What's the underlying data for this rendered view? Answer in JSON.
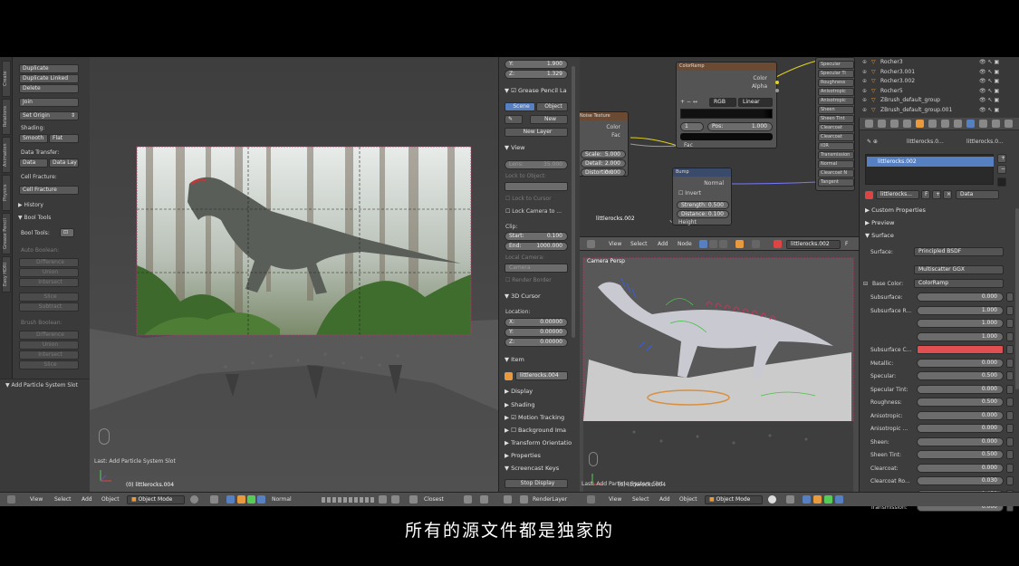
{
  "left_tools": {
    "duplicate": "Duplicate",
    "duplicate_linked": "Duplicate Linked",
    "delete": "Delete",
    "join": "Join",
    "set_origin": "Set Origin",
    "shading_label": "Shading:",
    "smooth": "Smooth",
    "flat": "Flat",
    "data_transfer_label": "Data Transfer:",
    "data": "Data",
    "data_lay": "Data Lay",
    "cell_fracture_label": "Cell Fracture:",
    "cell_fracture": "Cell Fracture",
    "history": "History",
    "bool_tools": "Bool Tools",
    "bool_tools_label": "Bool Tools:",
    "auto_boolean": "Auto Boolean:",
    "difference": "Difference",
    "union": "Union",
    "intersect": "Intersect",
    "slice": "Slice",
    "subtract": "Subtract",
    "brush_boolean": "Brush Boolean:",
    "difference2": "Difference",
    "union2": "Union",
    "intersect2": "Intersect",
    "slice2": "Slice",
    "add_particle": "Add Particle System Slot",
    "tabs": [
      "Create",
      "Relations",
      "Animation",
      "Physics",
      "Grease Pencil",
      "Easy HDRI"
    ]
  },
  "viewport_left": {
    "last_op": "Last: Add Particle System Slot",
    "object_label": "(0) littlerocks.004"
  },
  "center_props": {
    "y_label": "Y:",
    "y_value": "1.900",
    "z_label": "Z:",
    "z_value": "1.329",
    "grease_pencil": "Grease Pencil La",
    "scene": "Scene",
    "object": "Object",
    "new": "New",
    "new_layer": "New Layer",
    "view": "View",
    "lens_label": "Lens:",
    "lens_value": "35.000",
    "lock_to_object": "Lock to Object:",
    "lock_to_cursor": "Lock to Cursor",
    "lock_camera": "Lock Camera to ...",
    "clip": "Clip:",
    "start_label": "Start:",
    "start_value": "0.100",
    "end_label": "End:",
    "end_value": "1000.000",
    "local_camera": "Local Camera:",
    "camera": "Camera",
    "render_border": "Render Border",
    "cursor_3d": "3D Cursor",
    "location": "Location:",
    "x_label": "X:",
    "x_value": "0.00000",
    "y2_label": "Y:",
    "y2_value": "0.00000",
    "z2_label": "Z:",
    "z2_value": "0.00000",
    "item": "Item",
    "item_name": "littlerocks.004",
    "display": "Display",
    "shading": "Shading",
    "motion_tracking": "Motion Tracking",
    "background_images": "Background Ima",
    "transform_orientations": "Transform Orientatio",
    "properties": "Properties",
    "screencast_keys": "Screencast Keys",
    "stop_display": "Stop Display"
  },
  "node_editor": {
    "color_ramp": "ColorRamp",
    "color_out": "Color",
    "alpha_out": "Alpha",
    "rgb": "RGB",
    "linear": "Linear",
    "stop_index": "1",
    "pos_label": "Pos:",
    "pos_value": "1.000",
    "fac": "Fac",
    "noise_texture": "Noise Texture",
    "noise_color": "Color",
    "noise_fac": "Fac",
    "scale_label": "Scale:",
    "scale_value": "5.000",
    "detail_label": "Detail:",
    "detail_value": "2.000",
    "distortion_label": "Distortion:",
    "distortion_value": "0.000",
    "bump": "Bump",
    "normal_out": "Normal",
    "invert": "Invert",
    "strength_label": "Strength:",
    "strength_value": "0.500",
    "distance_label": "Distance:",
    "distance_value": "0.100",
    "height": "Height",
    "object_name": "littlerocks.002",
    "bsdf_inputs": [
      "Specular",
      "Specular Ti",
      "Roughness",
      "Anisotropic",
      "Anisotropic",
      "Sheen",
      "Sheen Tint",
      "Clearcoat",
      "Clearcoat",
      "IOR",
      "Transmission",
      "Normal",
      "Clearcoat N",
      "Tangent"
    ],
    "header": {
      "view": "View",
      "select": "Select",
      "add": "Add",
      "node": "Node",
      "material": "littlerocks.002",
      "f": "F"
    }
  },
  "viewport_right": {
    "camera_persp": "Camera Persp",
    "last_op": "Last: Add Particle System Slot",
    "object_label": "(0) littlerocks.004"
  },
  "outliner": {
    "items": [
      "Rocher3",
      "Rocher3.001",
      "Rocher3.002",
      "Rocher5",
      "ZBrush_default_group",
      "ZBrush_default_group.001"
    ]
  },
  "props_right": {
    "breadcrumb1": "littlerocks.0...",
    "breadcrumb2": "littlerocks.0...",
    "slot_name": "littlerocks.002",
    "material_name": "littlerocks...",
    "f": "F",
    "data": "Data",
    "custom_properties": "Custom Properties",
    "preview": "Preview",
    "surface": "Surface",
    "surface_label": "Surface:",
    "surface_value": "Principled BSDF",
    "multiscatter": "Multiscatter GGX",
    "base_color_label": "Base Color:",
    "base_color_value": "ColorRamp",
    "rows": [
      {
        "label": "Subsurface:",
        "value": "0.000"
      },
      {
        "label": "Subsurface R...",
        "value": "1.000"
      },
      {
        "label": "",
        "value": "1.000"
      },
      {
        "label": "",
        "value": "1.000"
      },
      {
        "label": "Subsurface C...",
        "value": ""
      },
      {
        "label": "Metallic:",
        "value": "0.000"
      },
      {
        "label": "Specular:",
        "value": "0.500"
      },
      {
        "label": "Specular Tint:",
        "value": "0.000"
      },
      {
        "label": "Roughness:",
        "value": "0.500"
      },
      {
        "label": "Anisotropic:",
        "value": "0.000"
      },
      {
        "label": "Anisotropic ...",
        "value": "0.000"
      },
      {
        "label": "Sheen:",
        "value": "0.000"
      },
      {
        "label": "Sheen Tint:",
        "value": "0.500"
      },
      {
        "label": "Clearcoat:",
        "value": "0.000"
      },
      {
        "label": "Clearcoat Ro...",
        "value": "0.030"
      },
      {
        "label": "IOR:",
        "value": "1.450"
      },
      {
        "label": "Transmission:",
        "value": "0.000"
      }
    ],
    "subsurface_color": "#e05050"
  },
  "bottom_bar": {
    "view": "View",
    "select": "Select",
    "add": "Add",
    "object": "Object",
    "mode": "Object Mode",
    "normal": "Normal",
    "closest": "Closest",
    "render_layer": "RenderLayer",
    "view2": "View",
    "select2": "Select",
    "add2": "Add",
    "object2": "Object",
    "mode2": "Object Mode"
  },
  "subtitle": "所有的源文件都是独家的",
  "colors": {
    "accent": "#5680c2",
    "selection": "#ff8c00"
  }
}
